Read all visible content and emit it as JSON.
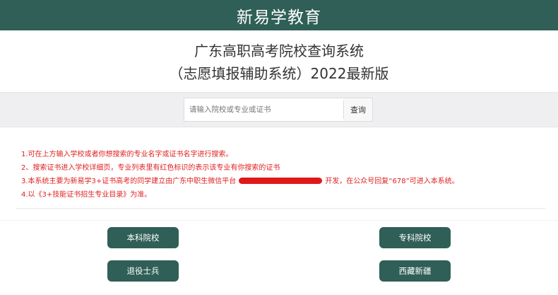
{
  "header": {
    "title": "新易学教育"
  },
  "titles": {
    "line1": "广东高职高考院校查询系统",
    "line2": "（志愿填报辅助系统）2022最新版"
  },
  "search": {
    "placeholder": "请输入院校或专业或证书",
    "value": "",
    "button_label": "查询"
  },
  "notes": {
    "n1": "1.可在上方输入学校或者你想搜索的专业名字或证书名字进行搜索。",
    "n2": "2、搜索证书进入学校详细页，专业列表里有红色标识的表示该专业有你搜索的证书",
    "n3_pre": "3.本系统主要为新易学3+证书高考的同学建立由广东中职生微信平台",
    "n3_post": "开发，在公众号回复“678”可进入本系统。",
    "n4": "4.以《3+技能证书招生专业目录》为准。"
  },
  "buttons": {
    "undergrad": "本科院校",
    "junior": "专科院校",
    "veteran": "退役士兵",
    "tibet": "西藏新疆"
  },
  "colors": {
    "brand": "#2f5f57",
    "note_red": "#e02020",
    "search_bg": "#efeff1"
  }
}
